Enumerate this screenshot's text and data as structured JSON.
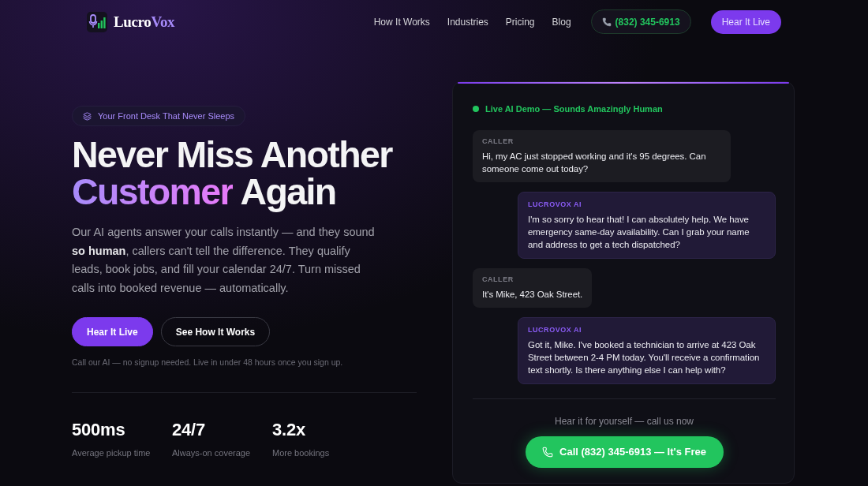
{
  "header": {
    "logo": {
      "words": [
        {
          "text": "Lucro",
          "kind": "plain"
        },
        {
          "text": "Vox",
          "kind": "accent"
        }
      ]
    },
    "nav_links": [
      "How It Works",
      "Industries",
      "Pricing",
      "Blog"
    ],
    "phone_button": "(832) 345-6913",
    "cta_button": "Hear It Live"
  },
  "hero": {
    "badge": "Your Front Desk That Never Sleeps",
    "headline": {
      "line_1": "Never Miss Another",
      "highlight": "Customer",
      "rest": "Again"
    },
    "description": "Our AI agents answer your calls instantly — and they sound **so human**, callers can't tell the difference. They qualify leads, book jobs, and fill your calendar 24/7. Turn missed calls into booked revenue — automatically.",
    "actions": [
      {
        "label": "Hear It Live",
        "kind": "primary"
      },
      {
        "label": "See How It Works",
        "kind": "secondary"
      }
    ],
    "note": "Call our AI — no signup needed. Live in under 48 hours once you sign up.",
    "stats": [
      {
        "value": "500ms",
        "label": "Average pickup time"
      },
      {
        "value": "24/7",
        "label": "Always-on coverage"
      },
      {
        "value": "3.2x",
        "label": "More bookings"
      }
    ]
  },
  "demo": {
    "status": "Live AI Demo — Sounds Amazingly Human",
    "messages": [
      {
        "kind": "caller",
        "speaker": "CALLER",
        "text": "Hi, my AC just stopped working and it's 95 degrees. Can someone come out today?"
      },
      {
        "kind": "ai",
        "speaker": "LUCROVOX AI",
        "text": "I'm so sorry to hear that! I can absolutely help. We have emergency same-day availability. Can I grab your name and address to get a tech dispatched?"
      },
      {
        "kind": "caller",
        "speaker": "CALLER",
        "text": "It's Mike, 423 Oak Street."
      },
      {
        "kind": "ai",
        "speaker": "LUCROVOX AI",
        "text": "Got it, Mike. I've booked a technician to arrive at 423 Oak Street between 2-4 PM today. You'll receive a confirmation text shortly. Is there anything else I can help with?"
      }
    ],
    "prompt": "Hear it for yourself — call us now",
    "call_button": "Call (832) 345-6913 — It's Free"
  }
}
